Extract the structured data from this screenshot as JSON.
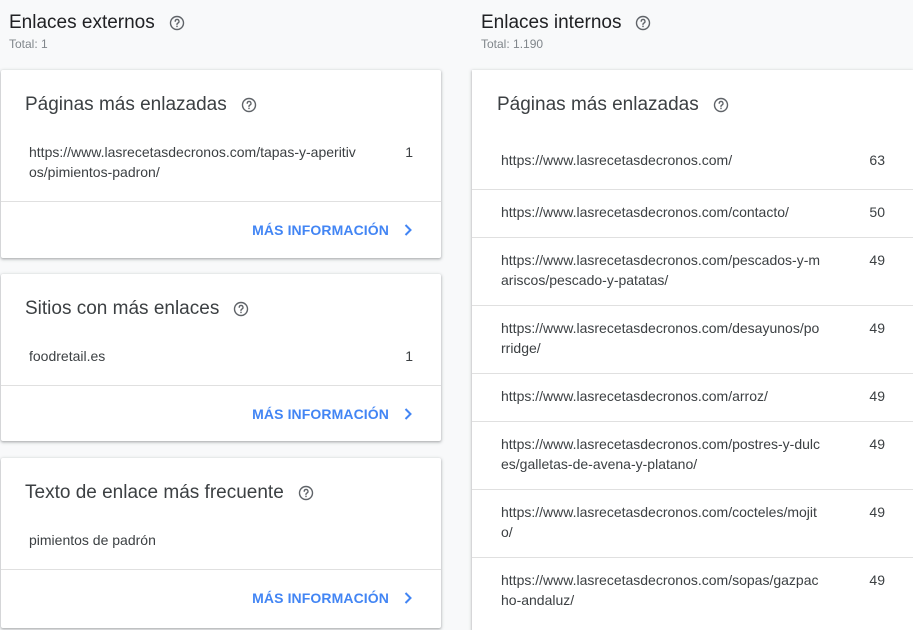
{
  "external": {
    "title": "Enlaces externos",
    "total": "Total: 1",
    "cards": [
      {
        "title": "Páginas más enlazadas",
        "rows": [
          {
            "url": "https://www.lasrecetasdecronos.com/tapas-y-aperitivos/pimientos-padron/",
            "count": "1"
          }
        ],
        "more_label": "MÁS INFORMACIÓN"
      },
      {
        "title": "Sitios con más enlaces",
        "rows": [
          {
            "url": "foodretail.es",
            "count": "1"
          }
        ],
        "more_label": "MÁS INFORMACIÓN"
      },
      {
        "title": "Texto de enlace más frecuente",
        "rows": [
          {
            "url": "pimientos de padrón",
            "count": ""
          }
        ],
        "more_label": "MÁS INFORMACIÓN"
      }
    ]
  },
  "internal": {
    "title": "Enlaces internos",
    "total": "Total: 1.190",
    "card": {
      "title": "Páginas más enlazadas",
      "rows": [
        {
          "url": "https://www.lasrecetasdecronos.com/",
          "count": "63"
        },
        {
          "url": "https://www.lasrecetasdecronos.com/contacto/",
          "count": "50"
        },
        {
          "url": "https://www.lasrecetasdecronos.com/pescados-y-mariscos/pescado-y-patatas/",
          "count": "49"
        },
        {
          "url": "https://www.lasrecetasdecronos.com/desayunos/porridge/",
          "count": "49"
        },
        {
          "url": "https://www.lasrecetasdecronos.com/arroz/",
          "count": "49"
        },
        {
          "url": "https://www.lasrecetasdecronos.com/postres-y-dulces/galletas-de-avena-y-platano/",
          "count": "49"
        },
        {
          "url": "https://www.lasrecetasdecronos.com/cocteles/mojito/",
          "count": "49"
        },
        {
          "url": "https://www.lasrecetasdecronos.com/sopas/gazpacho-andaluz/",
          "count": "49"
        }
      ]
    }
  },
  "icons": {
    "help": "help-circle-icon",
    "more": "chevron-right-icon"
  },
  "colors": {
    "accent": "#4285f4"
  }
}
